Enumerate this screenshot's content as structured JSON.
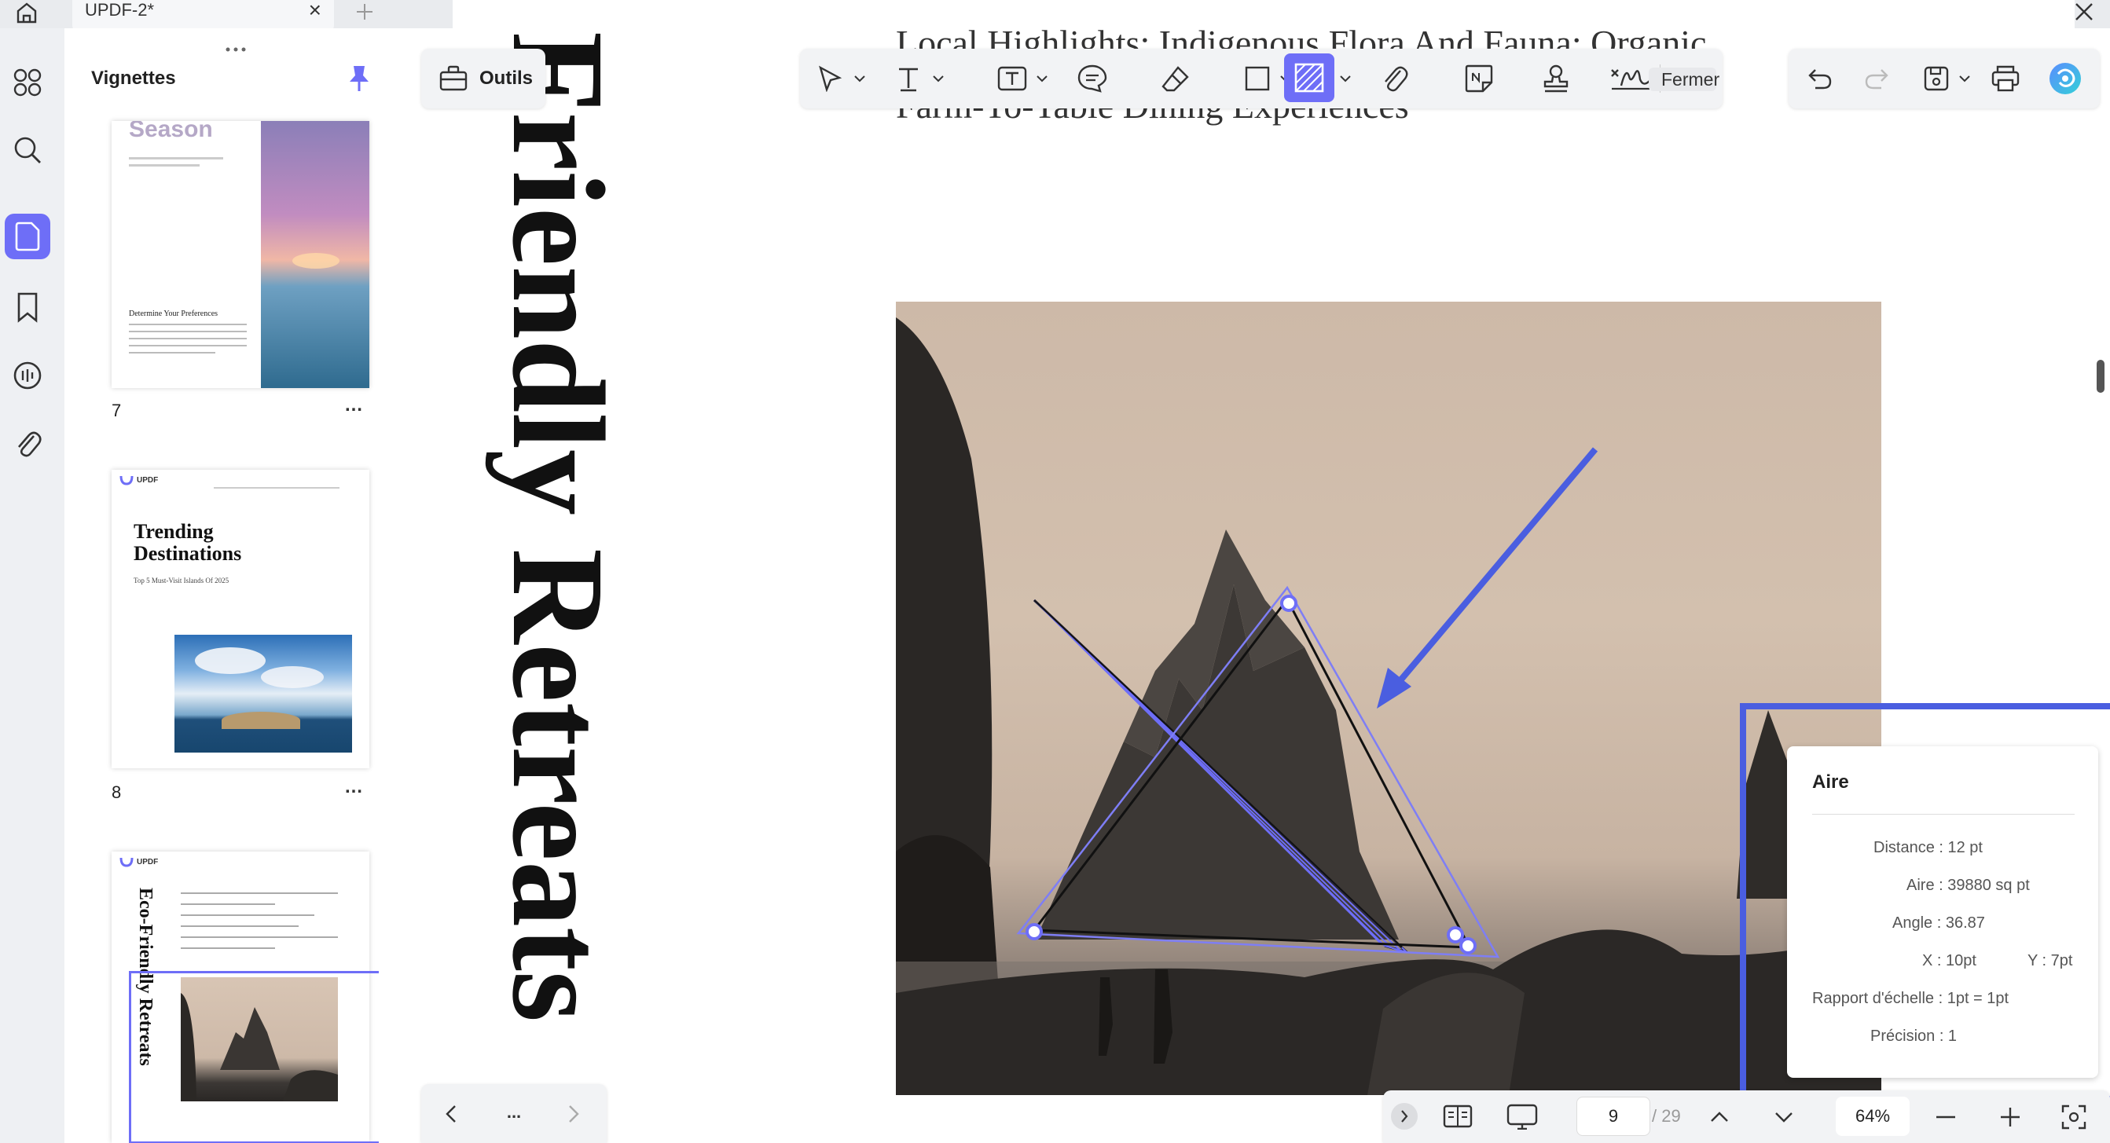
{
  "tab": {
    "title": "UPDF-2*"
  },
  "panel": {
    "title": "Vignettes"
  },
  "thumbnails": [
    {
      "page": "7",
      "heading": "Season",
      "subheading": "Determine Your Preferences"
    },
    {
      "page": "8",
      "logo": "UPDF",
      "heading_line1": "Trending",
      "heading_line2": "Destinations",
      "subtitle": "Top 5 Must-Visit Islands Of 2025"
    },
    {
      "page": "",
      "logo": "UPDF",
      "vertical_title": "Eco-Friendly Retreats"
    }
  ],
  "toolbar": {
    "tools_label": "Outils",
    "close_label": "Fermer"
  },
  "document": {
    "vertical_title": "Friendly Retreats",
    "line1": "Local Highlights: Indigenous Flora And Fauna; Organic",
    "line2": "Farm-To-Table Dining Experiences"
  },
  "measure": {
    "title": "Aire",
    "distance": "Distance : 12 pt",
    "area": "Aire : 39880 sq pt",
    "angle": "Angle : 36.87",
    "x": "X : 10pt",
    "y": "Y : 7pt",
    "scale": "Rapport d'échelle : 1pt = 1pt",
    "precision": "Précision : 1"
  },
  "pager": {
    "current": "9",
    "total": "/ 29",
    "zoom": "64%",
    "more": "..."
  },
  "colors": {
    "accent": "#6e6ef7",
    "annotation": "#4a5ee0",
    "highlight_border": "#4a5ee0"
  }
}
